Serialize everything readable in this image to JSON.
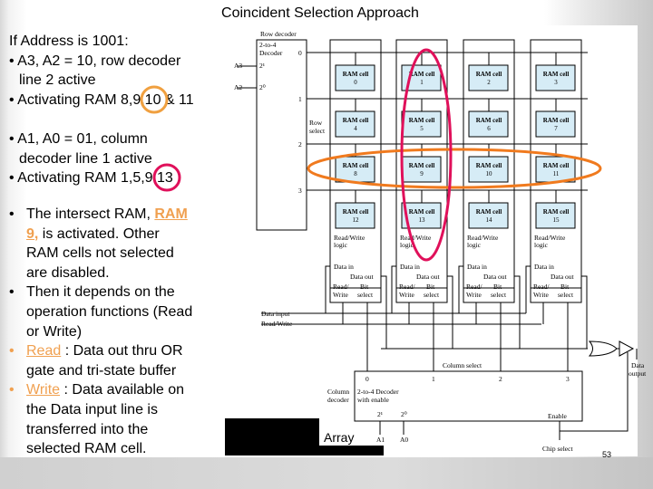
{
  "title": "Coincident Selection Approach",
  "intro": {
    "heading": "If Address is 1001:",
    "b1a": "A3, A2 = 10, row decoder",
    "b1b": "line 2 active",
    "b2": "Activating RAM 8,9,10 & 11",
    "b3a": "A1, A0 = 01, column",
    "b3b": "decoder line 1 active",
    "b4": "Activating RAM 1,5,9,13"
  },
  "bullets": {
    "p1a": "The intersect RAM, ",
    "p1link1": "RAM",
    "p1link2": "9,",
    "p1b": " is activated. Other",
    "p1c": "RAM cells not selected",
    "p1d": "are disabled.",
    "p2a": "Then it depends on the",
    "p2b": "operation functions (Read",
    "p2c": "or Write)",
    "p3link": "Read",
    "p3a": " : Data out thru OR",
    "p3b": "gate and tri-state buffer",
    "p4link": "Write",
    "p4a": " : Data available on",
    "p4b": "the Data input line is",
    "p4c": "transferred into the",
    "p4d": "selected RAM cell."
  },
  "diagram": {
    "row_decoder_label": "Row decoder",
    "decoder_type1": "2-to-4",
    "decoder_type2": "Decoder",
    "a3": "A3",
    "a2": "A2",
    "in1": "2¹",
    "in0": "2⁰",
    "row_select1": "Row",
    "row_select2": "select",
    "row_lines": [
      "0",
      "1",
      "2",
      "3"
    ],
    "cells": [
      "0",
      "1",
      "2",
      "3",
      "4",
      "5",
      "6",
      "7",
      "8",
      "9",
      "10",
      "11",
      "12",
      "13",
      "14",
      "15"
    ],
    "cell_label": "RAM cell",
    "rw_logic1": "Read/Write",
    "rw_logic2": "logic",
    "data_in": "Data in",
    "data_out": "Data out",
    "rw1": "Read/",
    "rw2": "Write",
    "bit1": "Bit",
    "bit2": "select",
    "data_input": "Data input",
    "read_write": "Read/Write",
    "column_select": "Column select",
    "col_lines": [
      "0",
      "1",
      "2",
      "3"
    ],
    "col_decoder1": "Column",
    "col_decoder2": "decoder",
    "col_dec_type1": "2-to-4 Decoder",
    "col_dec_type2": "with enable",
    "a1": "A1",
    "a0": "A0",
    "enable": "Enable",
    "chip_select": "Chip select",
    "data_output1": "Data",
    "data_output2": "output",
    "caption": "Array"
  },
  "page_number": "53",
  "colors": {
    "row_highlight": "#f07a1e",
    "column_highlight": "#e0105a",
    "cell_fill": "#d6ecf6",
    "link": "#f0a050"
  }
}
